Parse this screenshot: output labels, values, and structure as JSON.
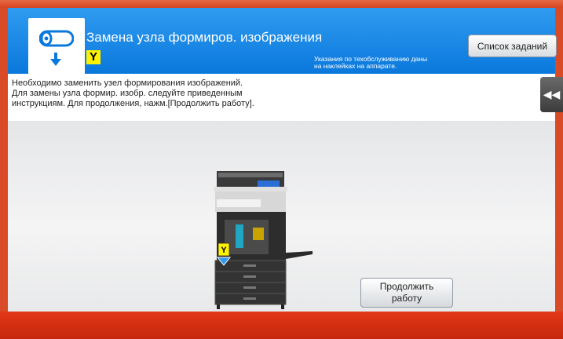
{
  "header": {
    "title": "Замена узла формиров. изображения",
    "color_label": "Y",
    "note_line1": "Указания по техобслуживанию даны",
    "note_line2": "на наклейках на аппарате.",
    "jobs_button_label": "Список заданий",
    "icons": [
      "toner-drum-icon",
      "down-arrow-icon"
    ]
  },
  "message": {
    "line1": "Необходимо заменить узел формирования изображений.",
    "line2": "Для замены узла формир. изобр. следуйте приведенным",
    "line3": "инструкциям. Для продолжения, нажм.[Продолжить работу]."
  },
  "collapse_button_icon": "double-left-arrow-icon",
  "machine": {
    "color_label": "Y"
  },
  "continue_button": {
    "line1": "Продолжить",
    "line2": "работу"
  },
  "colors": {
    "header_blue": "#0a78dc",
    "frame_red": "#d8431f",
    "badge_yellow": "#fff200"
  }
}
